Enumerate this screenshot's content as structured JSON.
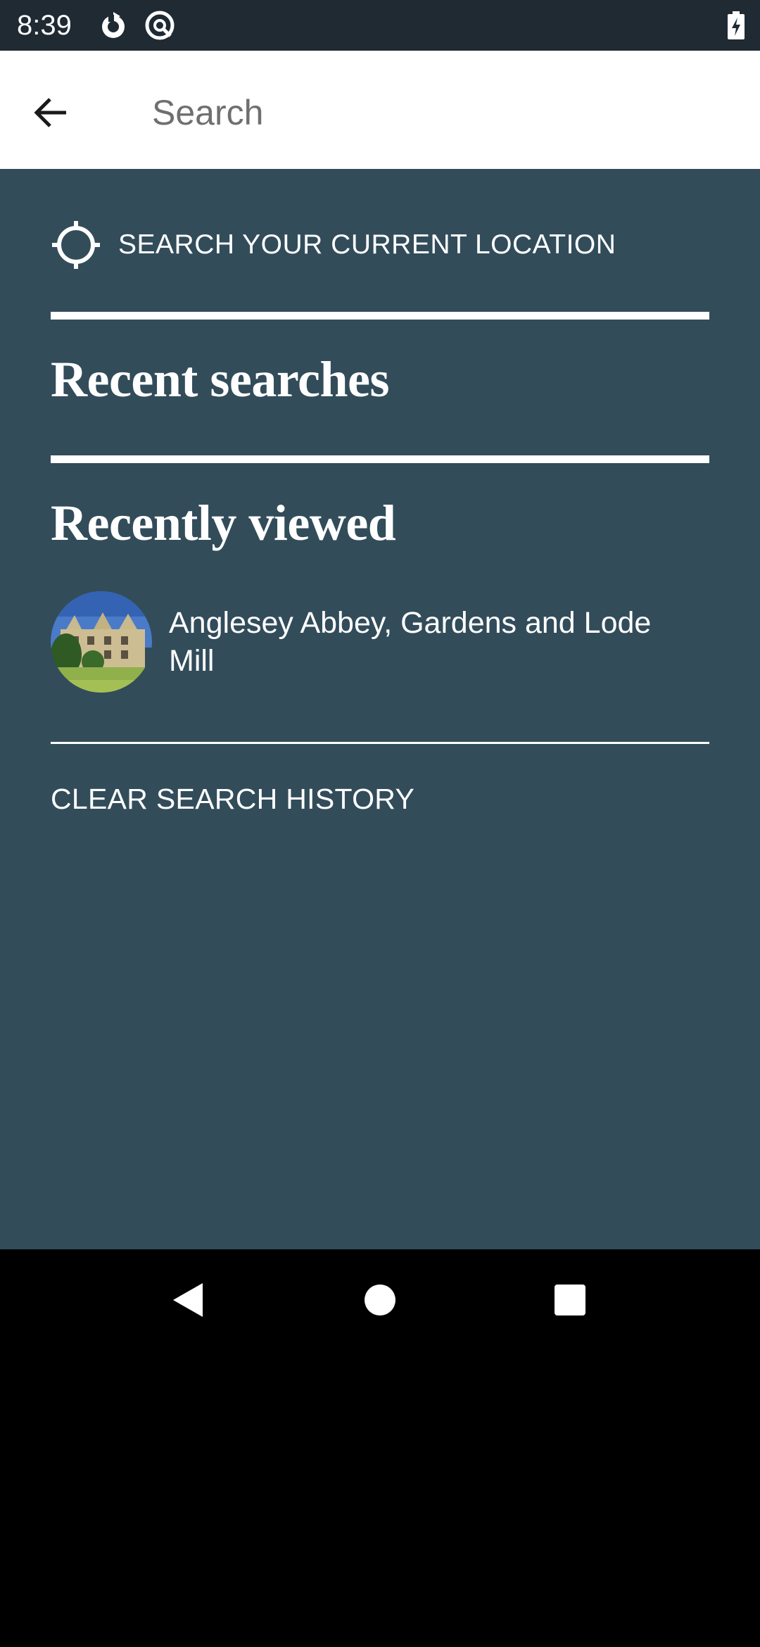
{
  "status_bar": {
    "time": "8:39",
    "icons": [
      "sync-icon",
      "at-sign-icon",
      "battery-charging-icon"
    ]
  },
  "search": {
    "placeholder": "Search",
    "value": ""
  },
  "location": {
    "label": "SEARCH YOUR CURRENT LOCATION",
    "icon": "gps-crosshair-icon"
  },
  "sections": {
    "recent_searches": "Recent searches",
    "recently_viewed": "Recently viewed"
  },
  "recently_viewed": [
    {
      "title": "Anglesey Abbey, Gardens and Lode Mill",
      "thumbnail": "manor-house-photo"
    }
  ],
  "actions": {
    "clear_history": "CLEAR SEARCH HISTORY"
  },
  "nav": {
    "buttons": [
      "back-triangle-icon",
      "home-circle-icon",
      "overview-square-icon"
    ]
  },
  "colors": {
    "status_bar": "#1f2a33",
    "content_background": "#324c5a",
    "search_background": "#ffffff",
    "text_on_dark": "#ffffff"
  }
}
